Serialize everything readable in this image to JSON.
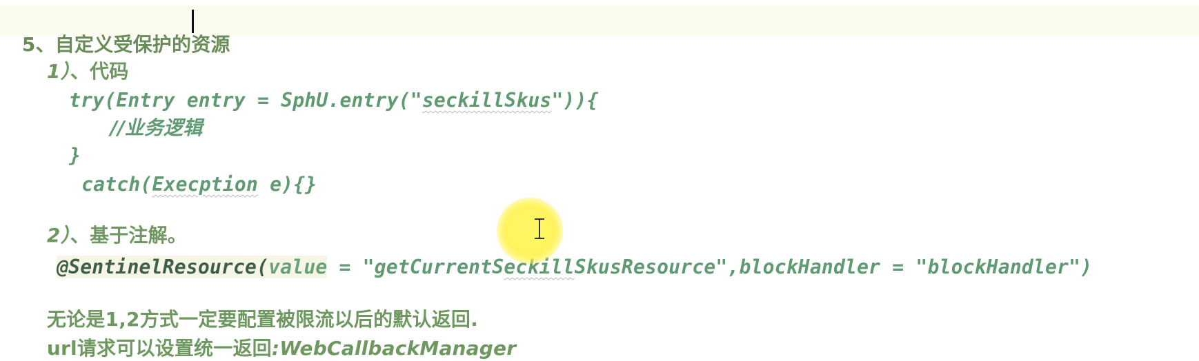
{
  "document": {
    "heading_number": "5、",
    "heading_part1": "自定义受保护",
    "heading_part2": "的资源",
    "sub1_number": "1）",
    "sub1_label": "、代码",
    "code1_prefix": "try(Entry entry = SphU.entry(\"",
    "code1_string": "seckillSkus",
    "code1_suffix": "\")){",
    "code2": "//业务逻辑",
    "code3": "}",
    "code4_prefix": "catch(",
    "code4_type": "Execption",
    "code4_suffix": " e){}",
    "sub2_number": "2）",
    "sub2_label": "、基于注解。",
    "annotation_name": "@SentinelResource(",
    "annotation_param": "value",
    "annotation_eq1": " = \"",
    "annotation_value1a": "getCurrentS",
    "annotation_value1b": "eckill",
    "annotation_value1c": "SkusResource",
    "annotation_middle": "\",blockHandler = \"",
    "annotation_value2": "blockHandler",
    "annotation_end": "\")",
    "note1": "无论是1,2方式一定要配置被限流以后的默认返回.",
    "note2_prefix": "url请求可以设置统一返回",
    "note2_suffix": ":WebCallbackManager"
  },
  "colors": {
    "text_green": "#5f9a72",
    "heading_green": "#6a8c57",
    "annotation_dark": "#3f5e49",
    "cursor_highlight": "#fff24f",
    "caret": "#111111"
  },
  "icons": {
    "text_cursor": "i-beam-cursor-icon"
  }
}
